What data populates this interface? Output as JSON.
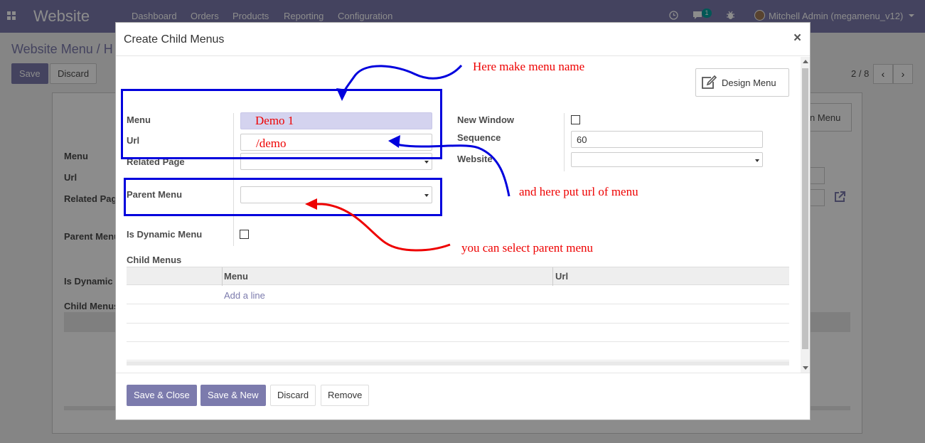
{
  "topbar": {
    "brand": "Website",
    "menu": [
      "Dashboard",
      "Orders",
      "Products",
      "Reporting",
      "Configuration"
    ],
    "chat_count": "1",
    "user": "Mitchell Admin (megamenu_v12)"
  },
  "breadcrumb": "Website Menu / H",
  "control": {
    "save": "Save",
    "discard": "Discard",
    "pager": "2 / 8",
    "prev": "‹",
    "next": "›"
  },
  "background_form": {
    "labels": [
      "Menu",
      "Url",
      "Related Pag",
      "Parent Menu",
      "Is Dynamic",
      "Child Menus"
    ],
    "design_menu_fragment": "n Menu"
  },
  "modal": {
    "title": "Create Child Menus",
    "close": "×",
    "design_menu": "Design Menu",
    "fields": {
      "menu_label": "Menu",
      "menu_value": "Demo 1",
      "url_label": "Url",
      "url_value": "/demo",
      "related_page_label": "Related Page",
      "related_page_value": "",
      "parent_menu_label": "Parent Menu",
      "parent_menu_value": "",
      "is_dynamic_label": "Is Dynamic Menu",
      "new_window_label": "New Window",
      "sequence_label": "Sequence",
      "sequence_value": "60",
      "website_label": "Website",
      "website_value": ""
    },
    "child_menus": {
      "label": "Child Menus",
      "columns": [
        "Menu",
        "Url"
      ],
      "add_line": "Add a line"
    },
    "footer": {
      "save_close": "Save & Close",
      "save_new": "Save & New",
      "discard": "Discard",
      "remove": "Remove"
    }
  },
  "annotations": {
    "menu_name": "Here make menu name",
    "url": "and here put url of menu",
    "parent": "you can select parent menu",
    "colors": {
      "text": "#ee0000",
      "box": "#0000dd",
      "red_arrow": "#ee0000"
    }
  }
}
